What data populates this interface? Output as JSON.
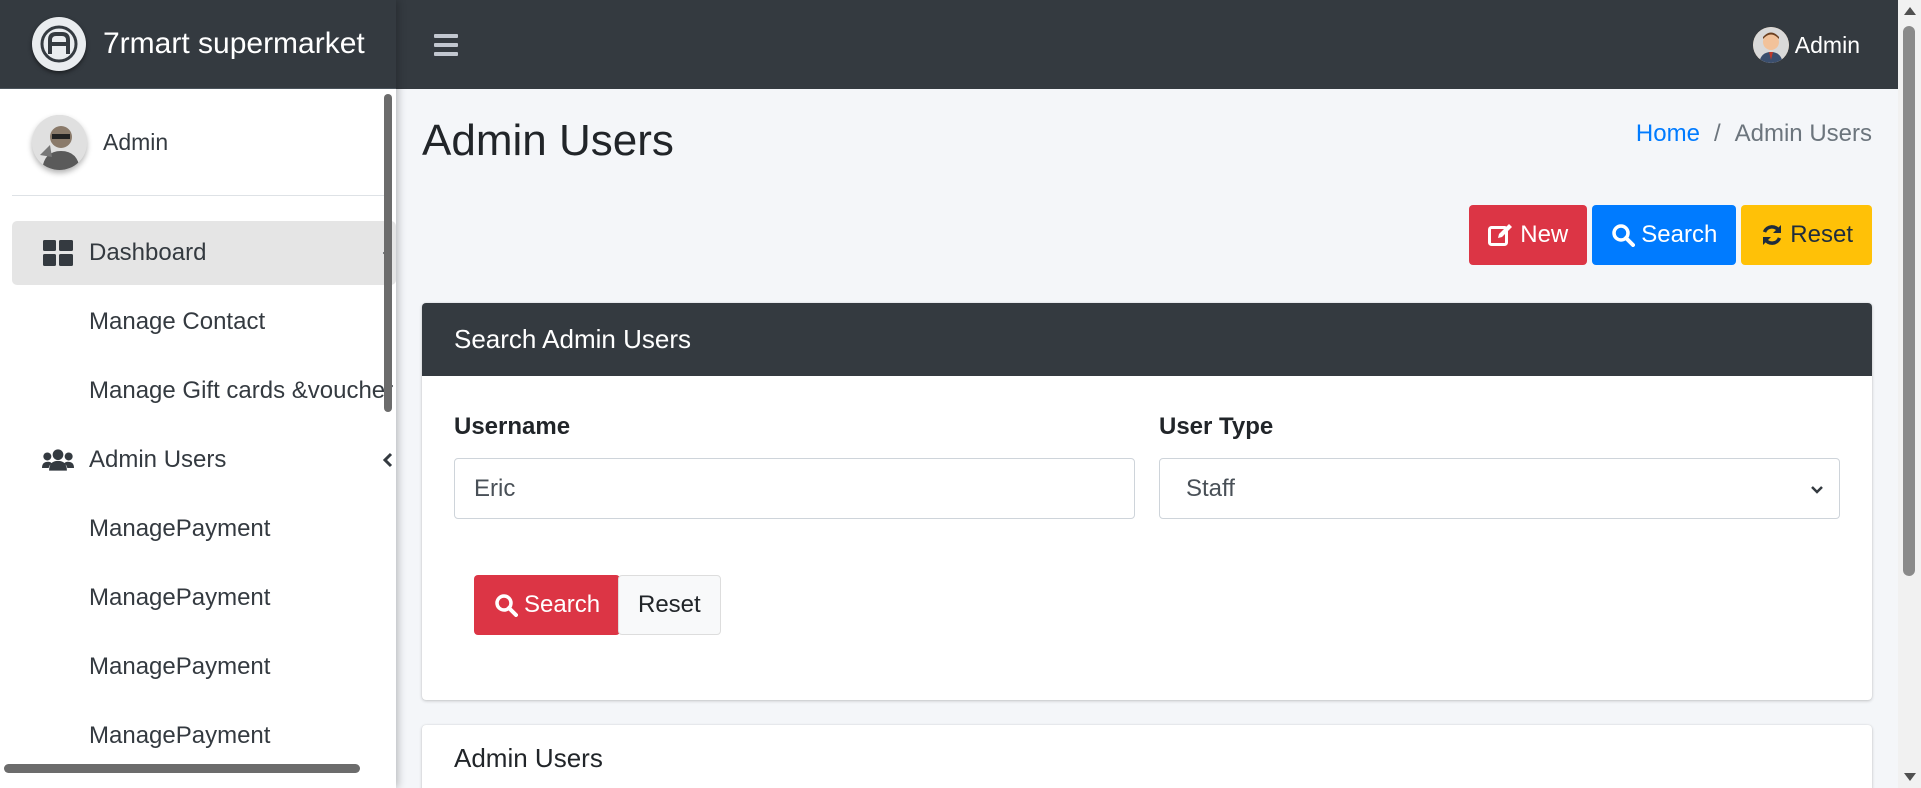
{
  "brand": {
    "name": "7rmart supermarket",
    "logo_icon": "brand-logo-icon"
  },
  "user_panel": {
    "name": "Admin"
  },
  "topbar": {
    "user_name": "Admin",
    "menu_icon": "hamburger-icon"
  },
  "sidebar": {
    "items": [
      {
        "label": "Dashboard",
        "icon": "dashboard-grid-icon",
        "active": true,
        "has_chevron": true
      },
      {
        "label": "Manage Contact",
        "sub": true
      },
      {
        "label": "Manage Gift cards &voucher",
        "sub": true
      },
      {
        "label": "Admin Users",
        "icon": "users-icon",
        "has_chevron": true
      },
      {
        "label": "ManagePayment",
        "sub": true
      },
      {
        "label": "ManagePayment",
        "sub": true
      },
      {
        "label": "ManagePayment",
        "sub": true
      },
      {
        "label": "ManagePayment",
        "sub": true
      }
    ]
  },
  "page": {
    "title": "Admin Users",
    "breadcrumb": {
      "home": "Home",
      "separator": "/",
      "current": "Admin Users"
    }
  },
  "actions": {
    "new_label": "New",
    "search_label": "Search",
    "reset_label": "Reset"
  },
  "search_card": {
    "header": "Search Admin Users",
    "username_label": "Username",
    "username_value": "Eric",
    "usertype_label": "User Type",
    "usertype_value": "Staff",
    "search_button": "Search",
    "reset_button": "Reset"
  },
  "list_card": {
    "title": "Admin Users"
  },
  "colors": {
    "danger": "#dc3545",
    "primary": "#007bff",
    "warning": "#ffc107",
    "dark": "#343a40",
    "link": "#007bff"
  }
}
